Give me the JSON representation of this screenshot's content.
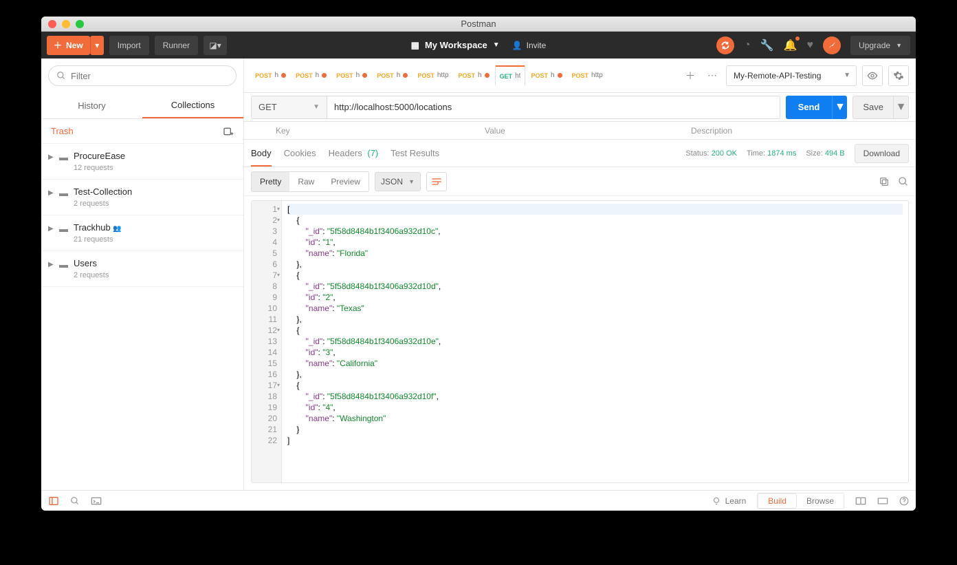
{
  "window": {
    "title": "Postman"
  },
  "topbar": {
    "new": "New",
    "import": "Import",
    "runner": "Runner",
    "workspace": "My Workspace",
    "invite": "Invite",
    "upgrade": "Upgrade"
  },
  "sidebar": {
    "filter_placeholder": "Filter",
    "tabs": {
      "history": "History",
      "collections": "Collections"
    },
    "trash": "Trash",
    "collections": [
      {
        "name": "ProcureEase",
        "sub": "12 requests",
        "shared": false
      },
      {
        "name": "Test-Collection",
        "sub": "2 requests",
        "shared": false
      },
      {
        "name": "Trackhub",
        "sub": "21 requests",
        "shared": true
      },
      {
        "name": "Users",
        "sub": "2 requests",
        "shared": false
      }
    ]
  },
  "request_tabs": [
    {
      "method": "POST",
      "label": "h",
      "dot": true
    },
    {
      "method": "POST",
      "label": "h",
      "dot": true
    },
    {
      "method": "POST",
      "label": "h",
      "dot": true
    },
    {
      "method": "POST",
      "label": "h",
      "dot": true
    },
    {
      "method": "POST",
      "label": "http",
      "dot": false
    },
    {
      "method": "POST",
      "label": "h",
      "dot": true
    },
    {
      "method": "GET",
      "label": "ht",
      "dot": false,
      "active": true
    },
    {
      "method": "POST",
      "label": "h",
      "dot": true
    },
    {
      "method": "POST",
      "label": "http",
      "dot": false
    }
  ],
  "environment": "My-Remote-API-Testing",
  "request": {
    "method": "GET",
    "url": "http://localhost:5000/locations",
    "send": "Send",
    "save": "Save"
  },
  "params_header": {
    "key": "Key",
    "value": "Value",
    "description": "Description"
  },
  "response_tabs": {
    "body": "Body",
    "cookies": "Cookies",
    "headers": "Headers",
    "headers_count": "(7)",
    "test_results": "Test Results"
  },
  "status": {
    "label": "Status:",
    "value": "200 OK",
    "time_label": "Time:",
    "time_value": "1874 ms",
    "size_label": "Size:",
    "size_value": "494 B",
    "download": "Download"
  },
  "view": {
    "pretty": "Pretty",
    "raw": "Raw",
    "preview": "Preview",
    "format": "JSON"
  },
  "code_lines": [
    "[",
    "    {",
    "        \"_id\": \"5f58d8484b1f3406a932d10c\",",
    "        \"id\": \"1\",",
    "        \"name\": \"Florida\"",
    "    },",
    "    {",
    "        \"_id\": \"5f58d8484b1f3406a932d10d\",",
    "        \"id\": \"2\",",
    "        \"name\": \"Texas\"",
    "    },",
    "    {",
    "        \"_id\": \"5f58d8484b1f3406a932d10e\",",
    "        \"id\": \"3\",",
    "        \"name\": \"California\"",
    "    },",
    "    {",
    "        \"_id\": \"5f58d8484b1f3406a932d10f\",",
    "        \"id\": \"4\",",
    "        \"name\": \"Washington\"",
    "    }",
    "]"
  ],
  "footer": {
    "learn": "Learn",
    "build": "Build",
    "browse": "Browse"
  }
}
